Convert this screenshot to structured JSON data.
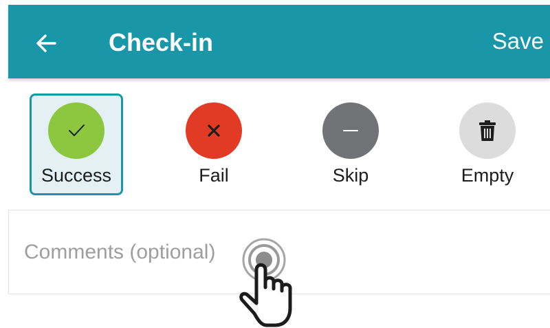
{
  "header": {
    "back_icon": "arrow-left-icon",
    "title": "Check-in",
    "save_label": "Save"
  },
  "status_options": [
    {
      "label": "Success",
      "icon": "checkmark-icon",
      "color": "#8dc63f",
      "selected": true
    },
    {
      "label": "Fail",
      "icon": "x-icon",
      "color": "#e13b25",
      "selected": false
    },
    {
      "label": "Skip",
      "icon": "dash-icon",
      "color": "#727377",
      "selected": false
    },
    {
      "label": "Empty",
      "icon": "trash-icon",
      "color": "#dcdcdc",
      "selected": false
    }
  ],
  "comments": {
    "placeholder": "Comments (optional)"
  },
  "colors": {
    "header": "#1a96a9",
    "accent": "#1a96a9",
    "selected_bg": "#e3f1f4"
  }
}
